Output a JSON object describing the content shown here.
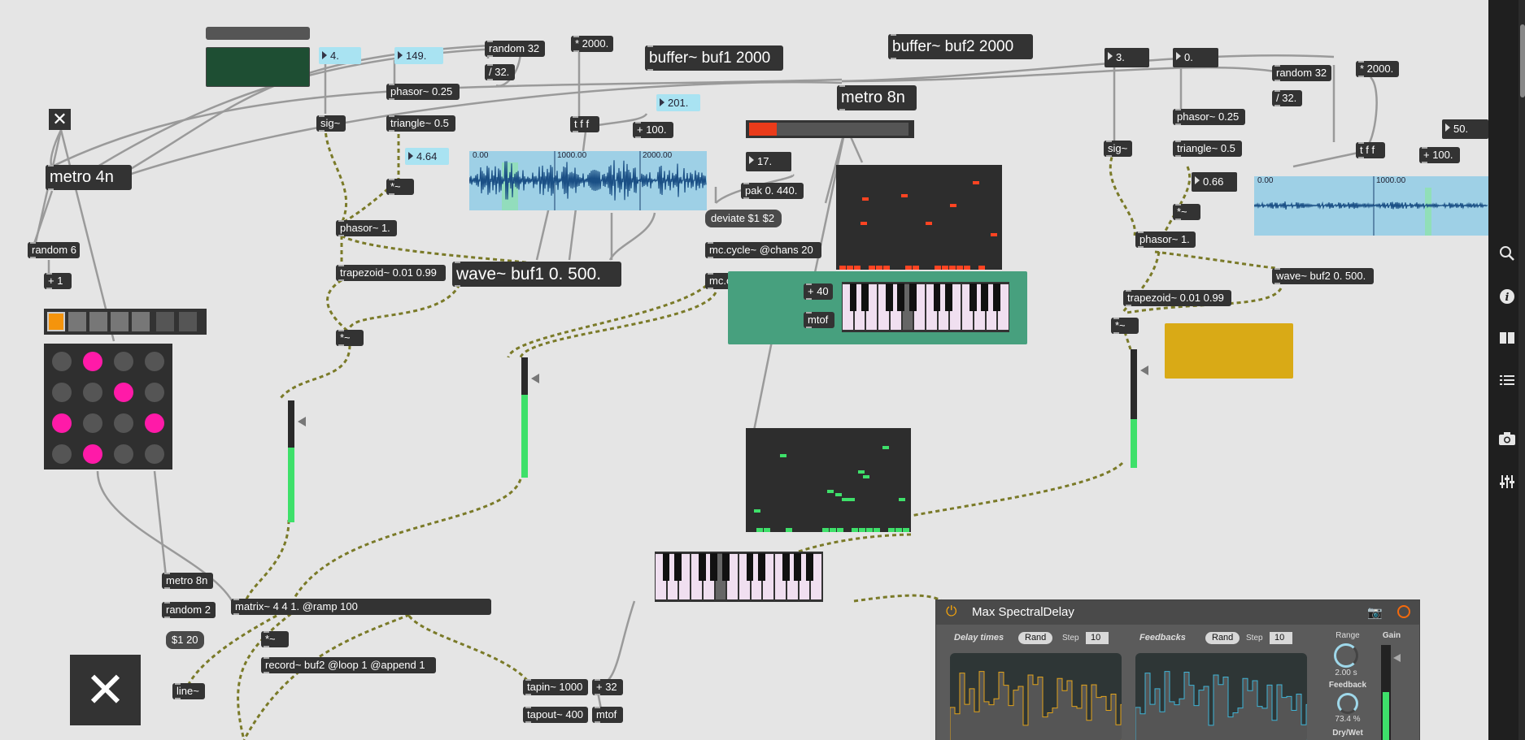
{
  "objects": {
    "metro_4n": "metro 4n",
    "random_6": "random 6",
    "plus_1": "+ 1",
    "sig_1": "sig~",
    "phasor_025_1": "phasor~ 0.25",
    "triangle_1": "triangle~ 0.5",
    "mult_1": "*~",
    "phasor_1_1": "phasor~ 1.",
    "trapezoid_1": "trapezoid~ 0.01 0.99",
    "mult_out_1": "*~",
    "random32_1": "random 32",
    "div32_1": "/ 32.",
    "mult2000_1": "* 2000.",
    "tff_1": "t f f",
    "plus100_1": "+ 100.",
    "buffer1": "buffer~ buf1 2000",
    "buffer2": "buffer~ buf2 2000",
    "wave1": "wave~ buf1 0. 500.",
    "metro_8n_big": "metro 8n",
    "pak": "pak 0. 440.",
    "deviate": "deviate $1 $2",
    "mccycle": "mc.cycle~ @chans 20",
    "mcop": "mc.op~ @op avg",
    "plus40": "+ 40",
    "mtof1": "mtof",
    "sig_2": "sig~",
    "phasor_025_2": "phasor~ 0.25",
    "triangle_2": "triangle~ 0.5",
    "mult_2": "*~",
    "phasor_1_2": "phasor~ 1.",
    "trapezoid_2": "trapezoid~ 0.01 0.99",
    "mult_out_2": "*~",
    "random32_2": "random 32",
    "div32_2": "/ 32.",
    "mult2000_2": "* 2000.",
    "tff_2": "t f f",
    "plus100_2": "+ 100.",
    "wave2": "wave~ buf2 0. 500.",
    "metro_8n_small": "metro 8n",
    "random_2": "random 2",
    "msg_120": "$1 20",
    "line": "line~",
    "matrix": "matrix~ 4 4 1. @ramp 100",
    "mult_rec": "*~",
    "record": "record~ buf2 @loop 1 @append 1",
    "tapin": "tapin~ 1000",
    "plus32": "+ 32",
    "tapout": "tapout~ 400",
    "mtof2": "mtof"
  },
  "numbers": {
    "n4": "4.",
    "n149": "149.",
    "n464": "4.64",
    "n201": "201.",
    "n17": "17.",
    "n3": "3.",
    "n0": "0.",
    "n066": "0.66",
    "n50": "50."
  },
  "waveform1": {
    "ticks": [
      "0.00",
      "1000.00",
      "2000.00"
    ]
  },
  "waveform2": {
    "ticks": [
      "0.00",
      "1000.00"
    ]
  },
  "spectral": {
    "title": "Max SpectralDelay",
    "delay_times": "Delay times",
    "feedbacks": "Feedbacks",
    "rand": "Rand",
    "step": "Step",
    "step_value": "10",
    "range_label": "Range",
    "range_value": "2.00 s",
    "feedback_label": "Feedback",
    "feedback_value": "73.4 %",
    "drywet_label": "Dry/Wet",
    "gain_label": "Gain"
  },
  "colors": {
    "accent_green": "#3ee06a",
    "magenta": "#ff1aa8",
    "orange": "#f5940c",
    "mustard": "#d9aa16",
    "teal_panel": "#47a07e",
    "red_notes": "#ff4422"
  },
  "sidebar": {
    "icons": [
      "search-icon",
      "info-icon",
      "book-icon",
      "list-icon",
      "camera-icon",
      "mixer-icon"
    ]
  }
}
